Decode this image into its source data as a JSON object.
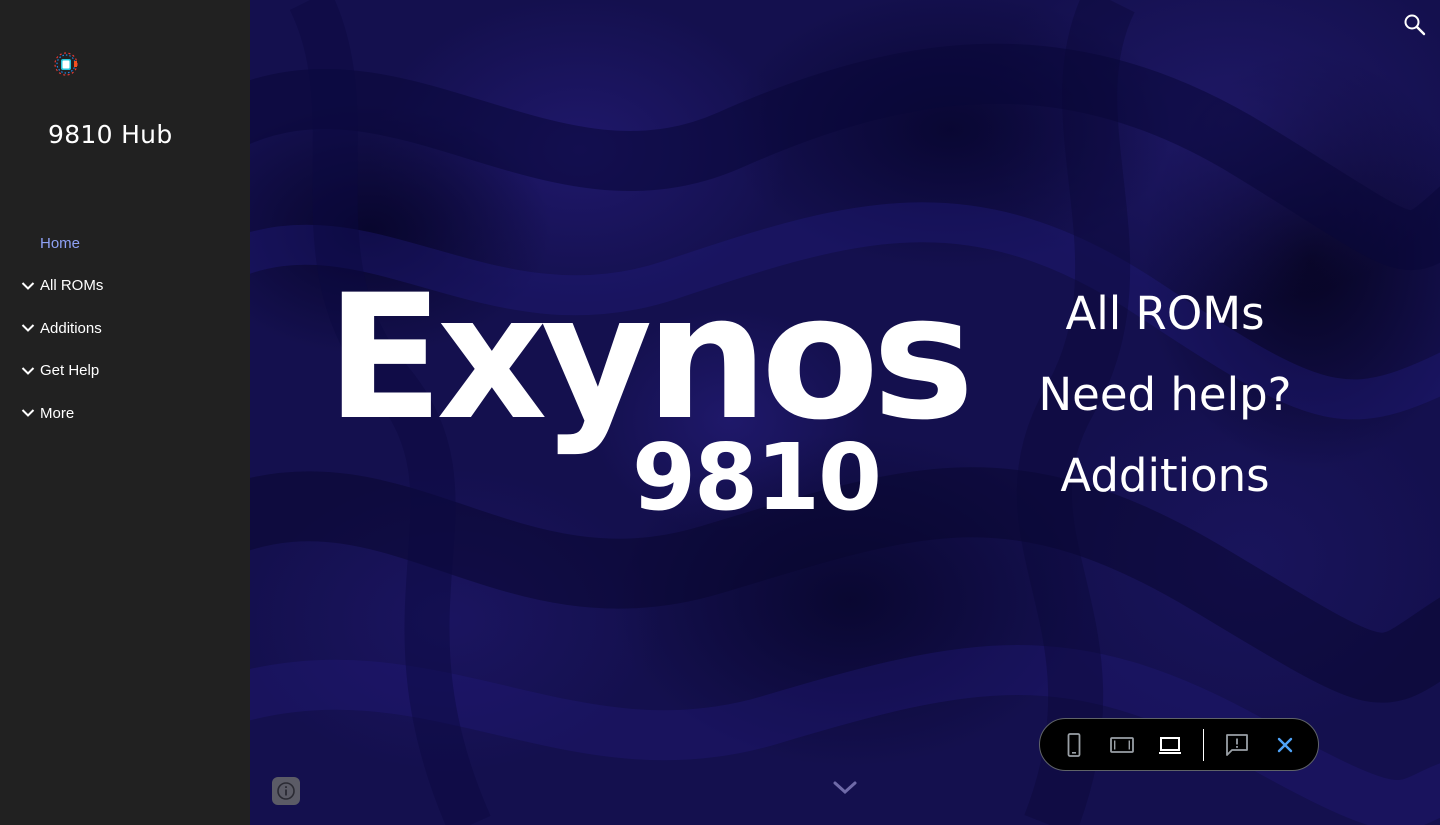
{
  "site": {
    "title": "9810 Hub",
    "logo_icon": "chip-logo-icon"
  },
  "sidebar": {
    "items": [
      {
        "label": "Home",
        "active": true,
        "expandable": false
      },
      {
        "label": "All ROMs",
        "active": false,
        "expandable": true
      },
      {
        "label": "Additions",
        "active": false,
        "expandable": true
      },
      {
        "label": "Get Help",
        "active": false,
        "expandable": true
      },
      {
        "label": "More",
        "active": false,
        "expandable": true
      }
    ]
  },
  "hero": {
    "brand": "Exynos",
    "chip": "9810",
    "links": [
      {
        "label": "All ROMs"
      },
      {
        "label": "Need help?"
      },
      {
        "label": "Additions"
      }
    ]
  },
  "icons": {
    "search": "search-icon",
    "info": "info-icon",
    "scroll_down": "chevron-down-icon",
    "phone": "phone-icon",
    "tablet": "tablet-icon",
    "laptop": "laptop-icon",
    "feedback": "feedback-icon",
    "close": "close-icon"
  },
  "colors": {
    "sidebar_bg": "#212121",
    "active_nav": "#8ea1f4",
    "hero_bg": "#14104e",
    "close_accent": "#4fa3f7"
  }
}
